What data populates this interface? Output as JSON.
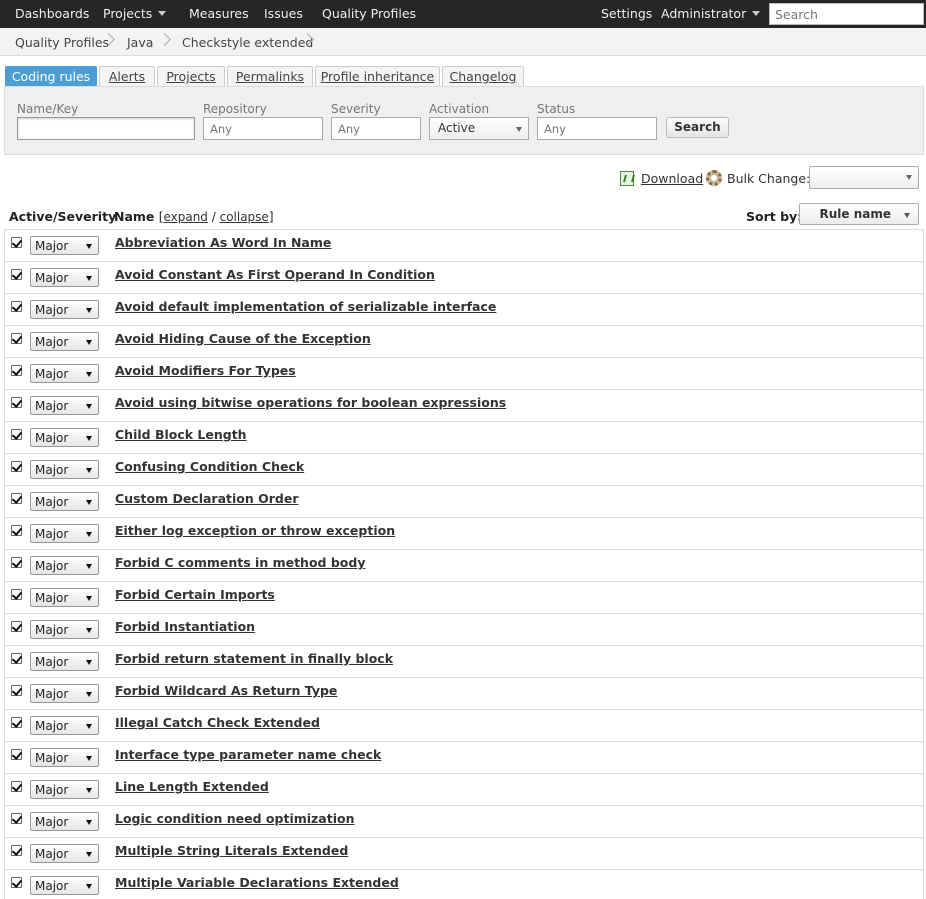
{
  "nav": {
    "dashboards": "Dashboards",
    "projects": "Projects",
    "measures": "Measures",
    "issues": "Issues",
    "quality_profiles": "Quality Profiles",
    "settings": "Settings",
    "user": "Administrator",
    "search_placeholder": "Search"
  },
  "breadcrumb": [
    "Quality Profiles",
    "Java",
    "Checkstyle extended"
  ],
  "tabs": [
    "Coding rules",
    "Alerts",
    "Projects",
    "Permalinks",
    "Profile inheritance",
    "Changelog"
  ],
  "filters": {
    "name_label": "Name/Key",
    "name_value": "",
    "repository_label": "Repository",
    "repository_placeholder": "Any",
    "severity_label": "Severity",
    "severity_placeholder": "Any",
    "activation_label": "Activation",
    "activation_value": "Active",
    "status_label": "Status",
    "status_placeholder": "Any",
    "search_button": "Search"
  },
  "toolbar": {
    "download": "Download",
    "bulk_change": "Bulk Change:",
    "bulk_value": ""
  },
  "table": {
    "col_active": "Active/Severity",
    "col_name": "Name",
    "bracket_open": "[",
    "expand": "expand",
    "sep": " / ",
    "collapse": "collapse",
    "bracket_close": "]",
    "sort_label": "Sort by:",
    "sort_value": "Rule name"
  },
  "rules": [
    {
      "severity": "Major",
      "name": "Abbreviation As Word In Name"
    },
    {
      "severity": "Major",
      "name": "Avoid Constant As First Operand In Condition"
    },
    {
      "severity": "Major",
      "name": "Avoid default implementation of serializable interface"
    },
    {
      "severity": "Major",
      "name": "Avoid Hiding Cause of the Exception"
    },
    {
      "severity": "Major",
      "name": "Avoid Modifiers For Types"
    },
    {
      "severity": "Major",
      "name": "Avoid using bitwise operations for boolean expressions"
    },
    {
      "severity": "Major",
      "name": "Child Block Length"
    },
    {
      "severity": "Major",
      "name": "Confusing Condition Check"
    },
    {
      "severity": "Major",
      "name": "Custom Declaration Order"
    },
    {
      "severity": "Major",
      "name": "Either log exception or throw exception"
    },
    {
      "severity": "Major",
      "name": "Forbid C comments in method body"
    },
    {
      "severity": "Major",
      "name": "Forbid Certain Imports"
    },
    {
      "severity": "Major",
      "name": "Forbid Instantiation"
    },
    {
      "severity": "Major",
      "name": "Forbid return statement in finally block"
    },
    {
      "severity": "Major",
      "name": "Forbid Wildcard As Return Type"
    },
    {
      "severity": "Major",
      "name": "Illegal Catch Check Extended"
    },
    {
      "severity": "Major",
      "name": "Interface type parameter name check"
    },
    {
      "severity": "Major",
      "name": "Line Length Extended"
    },
    {
      "severity": "Major",
      "name": "Logic condition need optimization"
    },
    {
      "severity": "Major",
      "name": "Multiple String Literals Extended"
    },
    {
      "severity": "Major",
      "name": "Multiple Variable Declarations Extended"
    }
  ],
  "colors": {
    "topbar": "#262626",
    "active_tab": "#4b9fd5"
  }
}
